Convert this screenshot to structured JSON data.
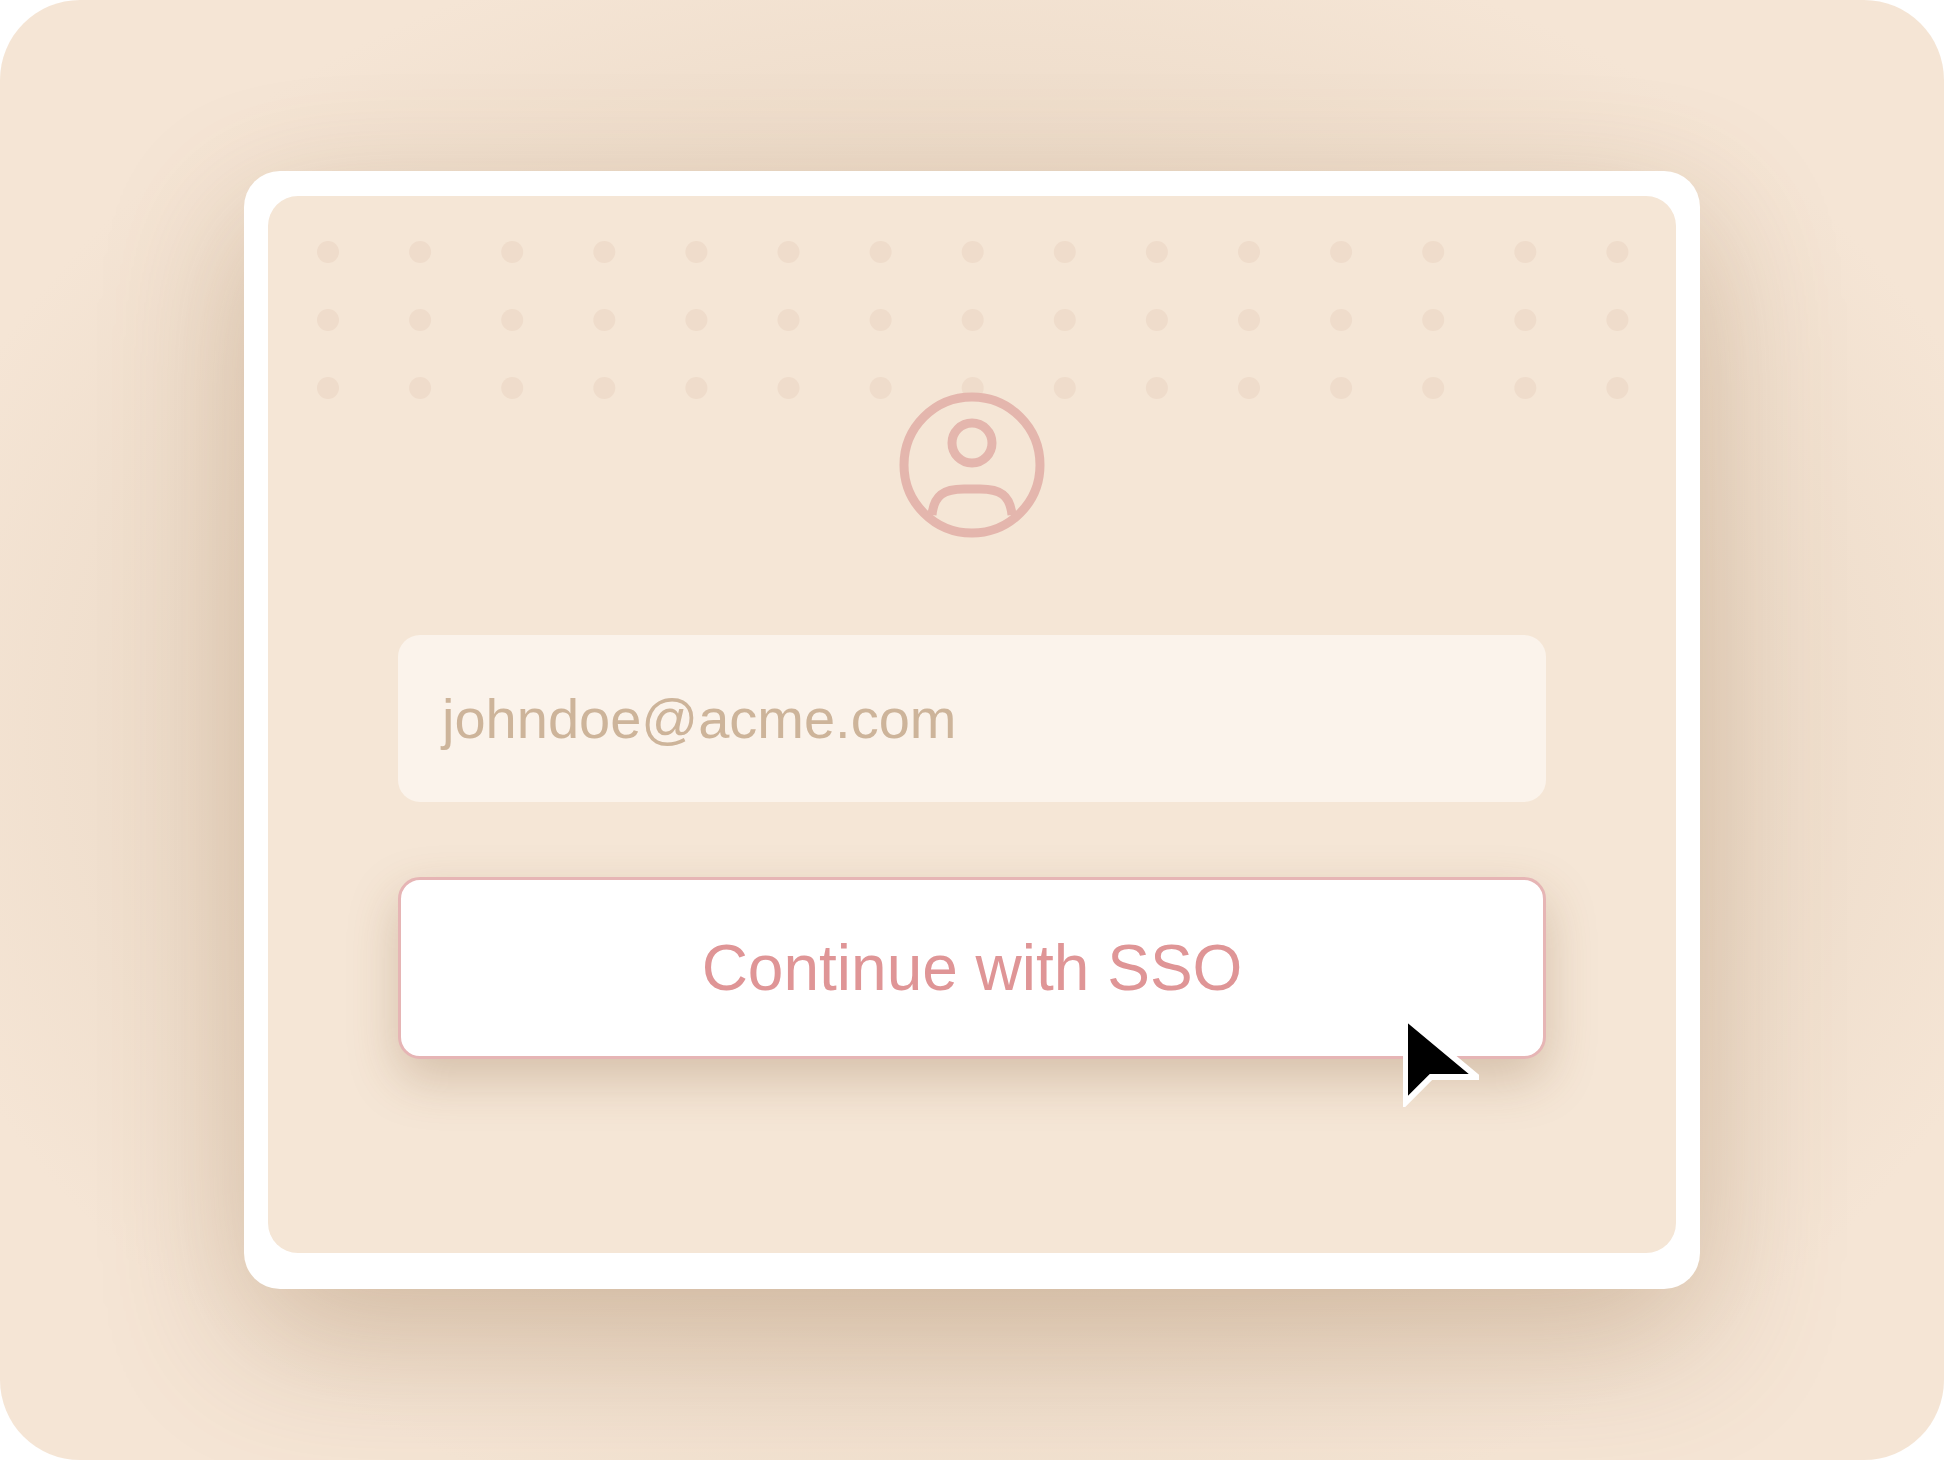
{
  "email_field": {
    "placeholder": "johndoe@acme.com"
  },
  "sso_button": {
    "label": "Continue with SSO"
  }
}
